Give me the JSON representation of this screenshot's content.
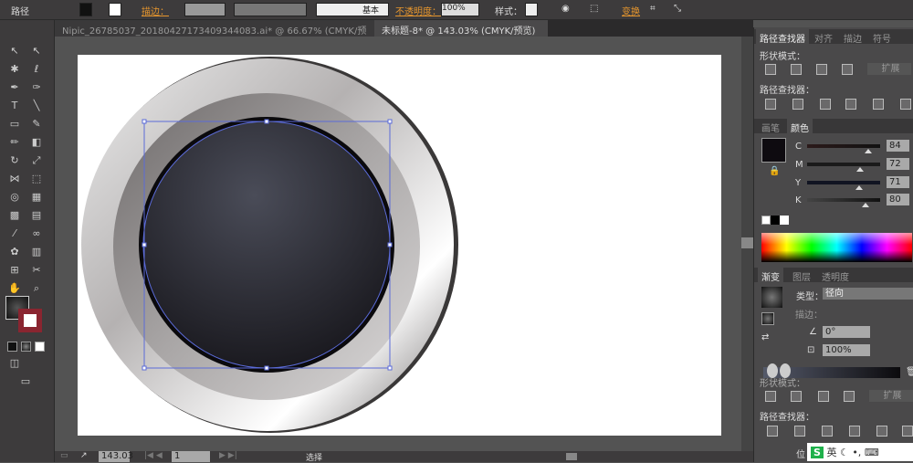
{
  "control_bar": {
    "object_type": "路径",
    "stroke_label": "描边：",
    "stroke_style": "基本",
    "opacity_label": "不透明度：",
    "opacity_value": "100%",
    "style_label": "样式：",
    "transform_label": "变换"
  },
  "doc_tabs": [
    {
      "label": "Nipic_26785037_20180427173409344083.ai* @ 66.67% (CMYK/预览)",
      "close": "×"
    },
    {
      "label": "未标题-8* @ 143.03% (CMYK/预览)",
      "close": "×",
      "active": true
    }
  ],
  "pathfinder_panel": {
    "tabs": [
      "路径查找器",
      "对齐",
      "描边",
      "符号"
    ],
    "shape_modes": "形状模式：",
    "pathfinders": "路径查找器：",
    "expand": "扩展"
  },
  "color_panel": {
    "tabs": [
      "画笔",
      "颜色"
    ],
    "channels": [
      {
        "name": "C",
        "value": "84",
        "percent": 84
      },
      {
        "name": "M",
        "value": "72",
        "percent": 72
      },
      {
        "name": "Y",
        "value": "71",
        "percent": 71
      },
      {
        "name": "K",
        "value": "80",
        "percent": 80
      }
    ],
    "fill_color": "#0e0b10"
  },
  "gradient_panel": {
    "tabs": [
      "渐变",
      "图层",
      "透明度"
    ],
    "type_label": "类型：",
    "type_value": "径向",
    "stroke_label": "描边：",
    "angle": "0°",
    "aspect": "100%"
  },
  "pathfinder_panel2": {
    "shape_modes": "形状模式：",
    "pathfinders": "路径查找器：",
    "expand": "扩展"
  },
  "status_bar": {
    "zoom": "143.03",
    "page": "1",
    "tool": "选择"
  },
  "ime": {
    "lang": "英",
    "pos": "位"
  }
}
